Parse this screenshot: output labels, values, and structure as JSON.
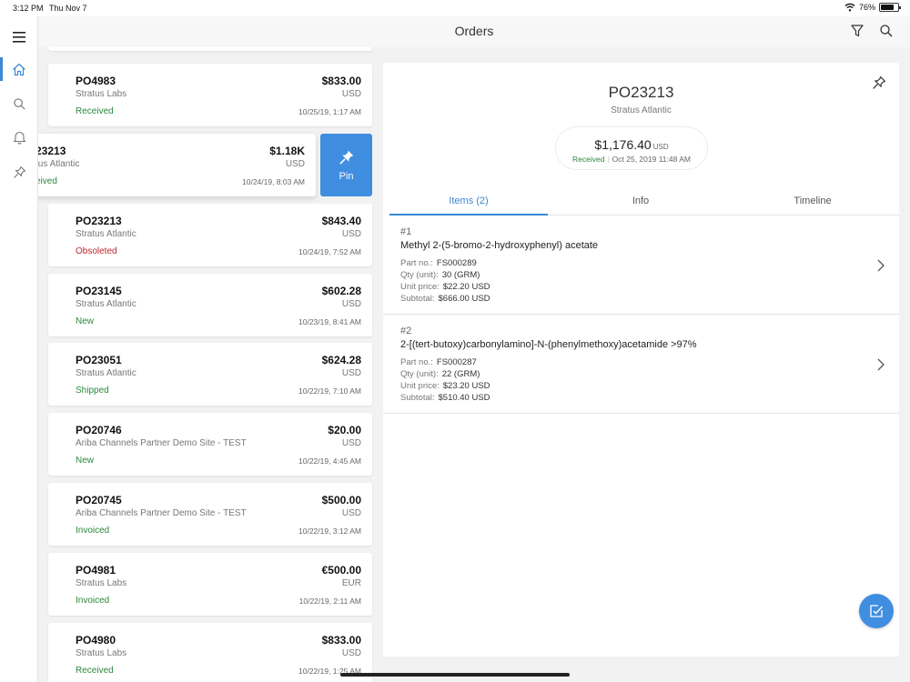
{
  "statusbar": {
    "time": "3:12 PM",
    "date": "Thu Nov 7",
    "battery": "76%"
  },
  "header": {
    "title": "Orders"
  },
  "orders": [
    {
      "po": "PO4983",
      "vendor": "Stratus Labs",
      "status": "Received",
      "amount": "$833.00",
      "currency": "USD",
      "timestamp": "10/25/19, 1:17 AM"
    },
    {
      "po": "PO23213",
      "vendor": "Stratus Atlantic",
      "status": "Received",
      "amount": "$1.18K",
      "currency": "USD",
      "timestamp": "10/24/19, 8:03 AM"
    },
    {
      "po": "PO23213",
      "vendor": "Stratus Atlantic",
      "status": "Obsoleted",
      "amount": "$843.40",
      "currency": "USD",
      "timestamp": "10/24/19, 7:52 AM"
    },
    {
      "po": "PO23145",
      "vendor": "Stratus Atlantic",
      "status": "New",
      "amount": "$602.28",
      "currency": "USD",
      "timestamp": "10/23/19, 8:41 AM"
    },
    {
      "po": "PO23051",
      "vendor": "Stratus Atlantic",
      "status": "Shipped",
      "amount": "$624.28",
      "currency": "USD",
      "timestamp": "10/22/19, 7:10 AM"
    },
    {
      "po": "PO20746",
      "vendor": "Ariba Channels Partner Demo  Site - TEST",
      "status": "New",
      "amount": "$20.00",
      "currency": "USD",
      "timestamp": "10/22/19, 4:45 AM"
    },
    {
      "po": "PO20745",
      "vendor": "Ariba Channels Partner Demo  Site - TEST",
      "status": "Invoiced",
      "amount": "$500.00",
      "currency": "USD",
      "timestamp": "10/22/19, 3:12 AM"
    },
    {
      "po": "PO4981",
      "vendor": "Stratus Labs",
      "status": "Invoiced",
      "amount": "€500.00",
      "currency": "EUR",
      "timestamp": "10/22/19, 2:11 AM"
    },
    {
      "po": "PO4980",
      "vendor": "Stratus Labs",
      "status": "Received",
      "amount": "$833.00",
      "currency": "USD",
      "timestamp": "10/22/19, 1:25 AM"
    }
  ],
  "swiped": {
    "po": "23213",
    "vendor": "tus Atlantic",
    "status": "eived"
  },
  "pin_action": {
    "label": "Pin"
  },
  "detail": {
    "po": "PO23213",
    "vendor": "Stratus Atlantic",
    "total": "$1,176.40",
    "total_currency": "USD",
    "status": "Received",
    "date": "Oct 25, 2019 11:48 AM",
    "tabs": [
      "Items (2)",
      "Info",
      "Timeline"
    ],
    "labels": {
      "part": "Part no.:",
      "qty": "Qty (unit):",
      "price": "Unit price:",
      "subtotal": "Subtotal:"
    },
    "items": [
      {
        "num": "#1",
        "name": "Methyl 2-(5-bromo-2-hydroxyphenyl) acetate",
        "part": "FS000289",
        "qty": "30 (GRM)",
        "price": "$22.20 USD",
        "subtotal": "$666.00 USD"
      },
      {
        "num": "#2",
        "name": "2-[(tert-butoxy)carbonylamino]-N-(phenylmethoxy)acetamide >97%",
        "part": "FS000287",
        "qty": "22 (GRM)",
        "price": "$23.20 USD",
        "subtotal": "$510.40 USD"
      }
    ]
  },
  "colors": {
    "accent": "#3b88d6",
    "received": "#2b8a3e",
    "obsoleted": "#c0262d"
  }
}
